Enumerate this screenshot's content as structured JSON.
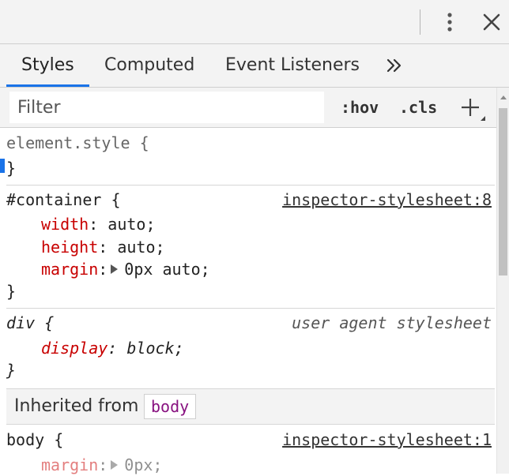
{
  "toolbar": {
    "more_icon": "kebab-vertical-icon",
    "close_icon": "close-x-icon"
  },
  "tabs": [
    {
      "label": "Styles",
      "active": true
    },
    {
      "label": "Computed",
      "active": false
    },
    {
      "label": "Event Listeners",
      "active": false
    }
  ],
  "tabs_more_icon": "double-chevron-right-icon",
  "filter": {
    "placeholder": "Filter",
    "value": "",
    "hov_label": ":hov",
    "cls_label": ".cls",
    "add_rule_icon": "plus-icon"
  },
  "rules": {
    "element_style": {
      "selector": "element.style {",
      "close": "}"
    },
    "container": {
      "selector": "#container {",
      "source": "inspector-stylesheet:8",
      "decls": [
        {
          "prop": "width",
          "value": " auto;"
        },
        {
          "prop": "height",
          "value": " auto;"
        },
        {
          "prop": "margin",
          "value": "0px auto;"
        }
      ],
      "close": "}"
    },
    "div": {
      "selector": "div {",
      "source": "user agent stylesheet",
      "decl": {
        "prop": "display",
        "value": " block;"
      },
      "close": "}"
    },
    "inherited": {
      "label": "Inherited from",
      "tag": "body"
    },
    "body": {
      "selector": "body {",
      "source": "inspector-stylesheet:1",
      "decl": {
        "prop": "margin",
        "value": "0px;"
      }
    }
  },
  "colors": {
    "accent": "#1a73e8",
    "property": "#c80000",
    "tag": "#881280"
  }
}
